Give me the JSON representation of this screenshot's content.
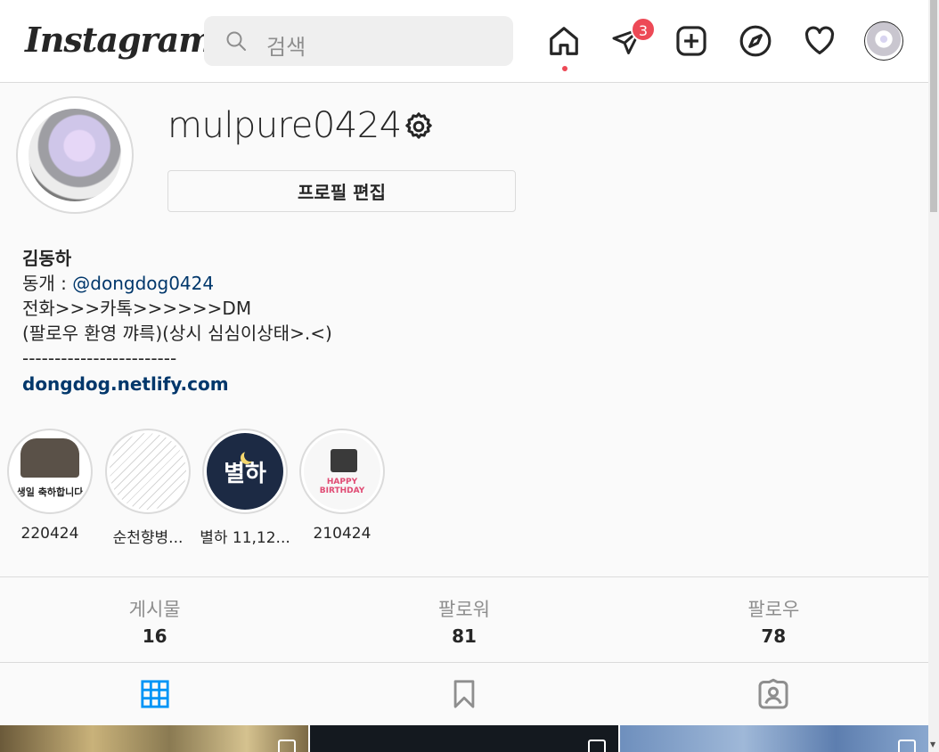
{
  "header": {
    "logo_text": "Instagram",
    "search_placeholder": "검색",
    "notification_count": "3"
  },
  "profile": {
    "username": "mulpure0424",
    "edit_button_label": "프로필 편집",
    "bio": {
      "name": "김동하",
      "line1_prefix": "동개 : ",
      "line1_mention": "@dongdog0424",
      "line2": "전화>>>카톡>>>>>>DM",
      "line3": "(팔로우 환영 꺄륵)(상시 심심이상태>.<)",
      "line4": "------------------------",
      "website": "dongdog.netlify.com"
    }
  },
  "highlights": [
    {
      "label": "220424",
      "cover_text": "생일 축하합니다"
    },
    {
      "label": "순천향병...",
      "cover_text": ""
    },
    {
      "label": "별하 11,12...",
      "cover_text": "별하"
    },
    {
      "label": "210424",
      "cover_text": "HAPPY BIRTHDAY"
    }
  ],
  "stats": [
    {
      "label": "게시물",
      "value": "16"
    },
    {
      "label": "팔로워",
      "value": "81"
    },
    {
      "label": "팔로우",
      "value": "78"
    }
  ],
  "tabs": [
    {
      "name": "posts",
      "icon": "grid-icon",
      "active": true
    },
    {
      "name": "saved",
      "icon": "bookmark-icon",
      "active": false
    },
    {
      "name": "tagged",
      "icon": "tagged-icon",
      "active": false
    }
  ],
  "colors": {
    "accent_blue": "#0095f6",
    "badge_red": "#ed4956",
    "link_blue": "#00376b"
  }
}
